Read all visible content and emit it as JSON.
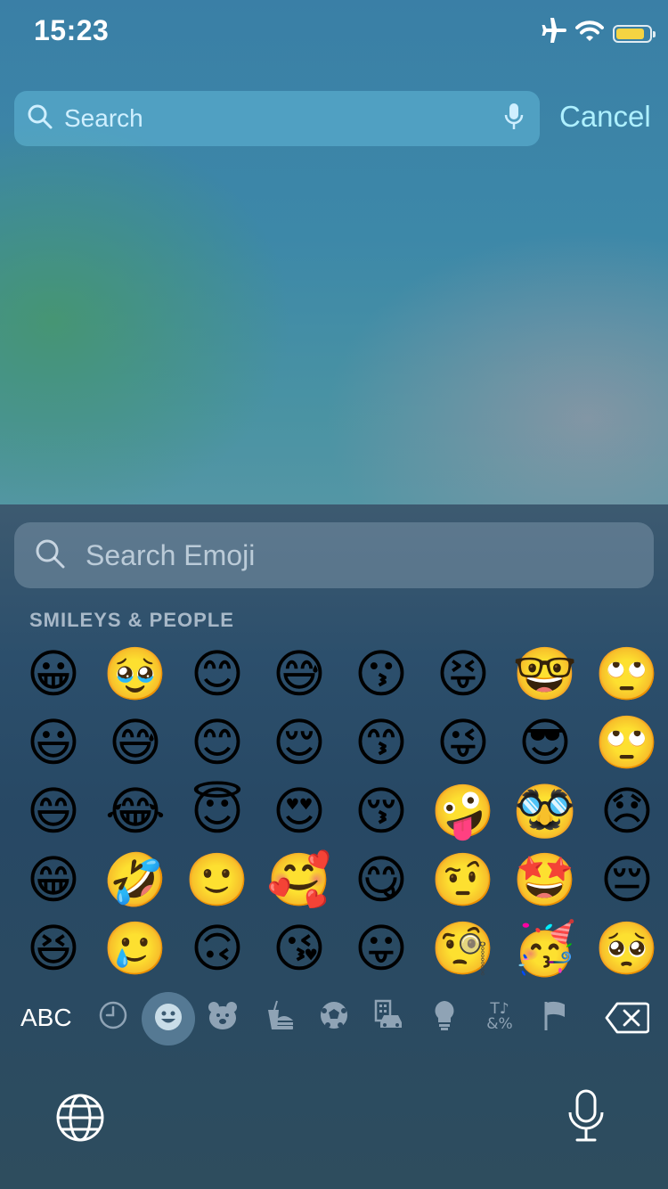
{
  "status_bar": {
    "time": "15:23",
    "icons": [
      "airplane-icon",
      "wifi-icon",
      "battery-icon"
    ],
    "battery_level": 0.85,
    "battery_color": "#f5d442"
  },
  "search": {
    "placeholder": "Search",
    "cancel_label": "Cancel"
  },
  "keyboard": {
    "search_placeholder": "Search Emoji",
    "section_title": "SMILEYS & PEOPLE",
    "emojis": [
      "😀",
      "🥹",
      "😊",
      "😅",
      "😗",
      "😝",
      "🤓",
      "🙄",
      "😃",
      "😅",
      "😊",
      "😌",
      "😙",
      "😜",
      "😎",
      "🙄",
      "😄",
      "😂",
      "😇",
      "😍",
      "😚",
      "🤪",
      "🥸",
      "😞",
      "😁",
      "🤣",
      "🙂",
      "🥰",
      "😋",
      "🤨",
      "🤩",
      "😔",
      "😆",
      "🥲",
      "🙃",
      "😘",
      "😛",
      "🧐",
      "🥳",
      "🥺"
    ],
    "abc_label": "ABC",
    "categories": [
      {
        "name": "recent",
        "icon": "clock-icon",
        "active": false
      },
      {
        "name": "smileys",
        "icon": "smiley-icon",
        "active": true
      },
      {
        "name": "animals",
        "icon": "bear-icon",
        "active": false
      },
      {
        "name": "food",
        "icon": "burger-icon",
        "active": false
      },
      {
        "name": "activity",
        "icon": "soccer-ball-icon",
        "active": false
      },
      {
        "name": "travel",
        "icon": "building-car-icon",
        "active": false
      },
      {
        "name": "objects",
        "icon": "lightbulb-icon",
        "active": false
      },
      {
        "name": "symbols",
        "icon": "symbols-icon",
        "active": false
      },
      {
        "name": "flags",
        "icon": "flag-icon",
        "active": false
      }
    ],
    "symbols_glyph_top": "T♪",
    "symbols_glyph_bottom": "&%",
    "accent_color": "#aef0ff"
  }
}
